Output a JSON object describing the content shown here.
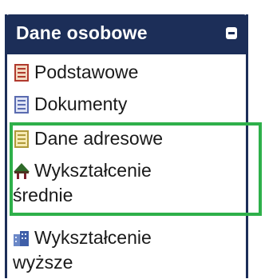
{
  "panel": {
    "title": "Dane osobowe",
    "collapse_icon": "minus-icon"
  },
  "items": [
    {
      "label": "Podstawowe",
      "icon": "form-red-icon"
    },
    {
      "label": "Dokumenty",
      "icon": "form-blue-icon"
    },
    {
      "label": "Dane adresowe",
      "icon": "form-yellow-icon"
    },
    {
      "label_line1": "Wykształcenie",
      "label_line2": "średnie",
      "icon": "tree-icon"
    },
    {
      "label_line1": "Wykształcenie",
      "label_line2": "wyższe",
      "icon": "building-icon"
    }
  ],
  "colors": {
    "header": "#1c2e58",
    "highlight": "#2eb04a"
  }
}
